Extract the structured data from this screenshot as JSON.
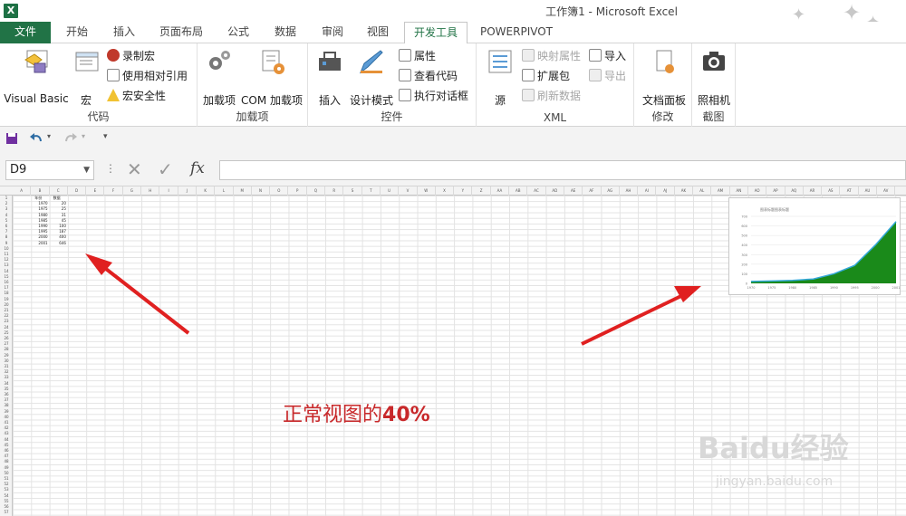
{
  "window": {
    "title": "工作簿1 - Microsoft Excel",
    "logo": "X"
  },
  "tabs": [
    {
      "label": "文件"
    },
    {
      "label": "开始"
    },
    {
      "label": "插入"
    },
    {
      "label": "页面布局"
    },
    {
      "label": "公式"
    },
    {
      "label": "数据"
    },
    {
      "label": "审阅"
    },
    {
      "label": "视图"
    },
    {
      "label": "开发工具"
    },
    {
      "label": "POWERPIVOT"
    }
  ],
  "ribbon": {
    "code": {
      "label": "代码",
      "visual_basic": "Visual Basic",
      "macro": "宏",
      "record_macro": "录制宏",
      "relative_ref": "使用相对引用",
      "macro_security": "宏安全性"
    },
    "addins": {
      "label": "加载项",
      "addins": "加载项",
      "com_addins": "COM 加载项"
    },
    "controls": {
      "label": "控件",
      "insert": "插入",
      "design_mode": "设计模式",
      "properties": "属性",
      "view_code": "查看代码",
      "run_dialog": "执行对话框"
    },
    "xml": {
      "label": "XML",
      "source": "源",
      "map_props": "映射属性",
      "expansion": "扩展包",
      "refresh": "刷新数据",
      "import": "导入",
      "export": "导出"
    },
    "modify": {
      "label": "修改",
      "doc_panel": "文档面板"
    },
    "screenshot": {
      "label": "截图",
      "camera": "照相机"
    }
  },
  "formula_bar": {
    "name_box": "D9",
    "fx": "fx",
    "value": ""
  },
  "columns": [
    "A",
    "B",
    "C",
    "D",
    "E",
    "F",
    "G",
    "H",
    "I",
    "J",
    "K",
    "L",
    "M",
    "N",
    "O",
    "P",
    "Q",
    "R",
    "S",
    "T",
    "U",
    "V",
    "W",
    "X",
    "Y",
    "Z",
    "AA",
    "AB",
    "AC",
    "AD",
    "AE",
    "AF",
    "AG",
    "AH",
    "AI",
    "AJ",
    "AK",
    "AL",
    "AM",
    "AN",
    "AO",
    "AP",
    "AQ",
    "AR",
    "AS",
    "AT",
    "AU",
    "AV"
  ],
  "sheet_data": {
    "headers": [
      "年份",
      "数据"
    ],
    "rows": [
      [
        "1970",
        "20"
      ],
      [
        "1975",
        "25"
      ],
      [
        "1980",
        "31"
      ],
      [
        "1985",
        "45"
      ],
      [
        "1990",
        "100"
      ],
      [
        "1995",
        "187"
      ],
      [
        "2000",
        "400"
      ],
      [
        "2001",
        "646"
      ]
    ]
  },
  "chart_data": {
    "type": "area",
    "title": "图表标题图表标题",
    "x": [
      "1970",
      "1975",
      "1980",
      "1985",
      "1990",
      "1995",
      "2000",
      "2001"
    ],
    "series": [
      {
        "values": [
          20,
          25,
          31,
          45,
          100,
          187,
          400,
          646
        ]
      }
    ],
    "ylim": [
      0,
      700
    ],
    "yticks": [
      "700",
      "600",
      "500",
      "400",
      "300",
      "200",
      "100",
      "0"
    ],
    "colors": {
      "fill": "#1a8a1a",
      "line": "#33a8d8"
    }
  },
  "annotation": {
    "caption_text": "正常视图的",
    "caption_bold": "40%",
    "color": "#c8282a"
  },
  "watermark": {
    "text": "Baidu经验",
    "url": "jingyan.baidu.com"
  }
}
